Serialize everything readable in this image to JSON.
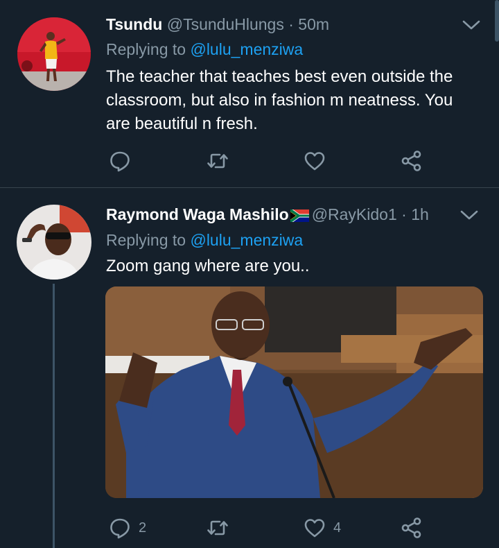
{
  "tweets": [
    {
      "name": "Tsundu",
      "handle": "@TsunduHlungs",
      "separator": "·",
      "time": "50m",
      "replying_prefix": "Replying to ",
      "replying_to": "@lulu_menziwa",
      "text_lines": [
        "The teacher that teaches best even outside the",
        "classroom, but also in fashion m neatness. You",
        "are beautiful n fresh."
      ],
      "reply_count": "",
      "retweet_count": "",
      "like_count": ""
    },
    {
      "name": "Raymond Waga Mashilo",
      "flag": "south-africa-flag",
      "handle": "@RayKido1",
      "separator": "·",
      "time": "1h",
      "replying_prefix": "Replying to ",
      "replying_to": "@lulu_menziwa",
      "text_lines": [
        "Zoom gang where are you.."
      ],
      "reply_count": "2",
      "retweet_count": "",
      "like_count": "4"
    }
  ],
  "colors": {
    "background": "#15202b",
    "muted": "#8899a6",
    "link": "#1da1f2",
    "divider": "#38444d"
  }
}
